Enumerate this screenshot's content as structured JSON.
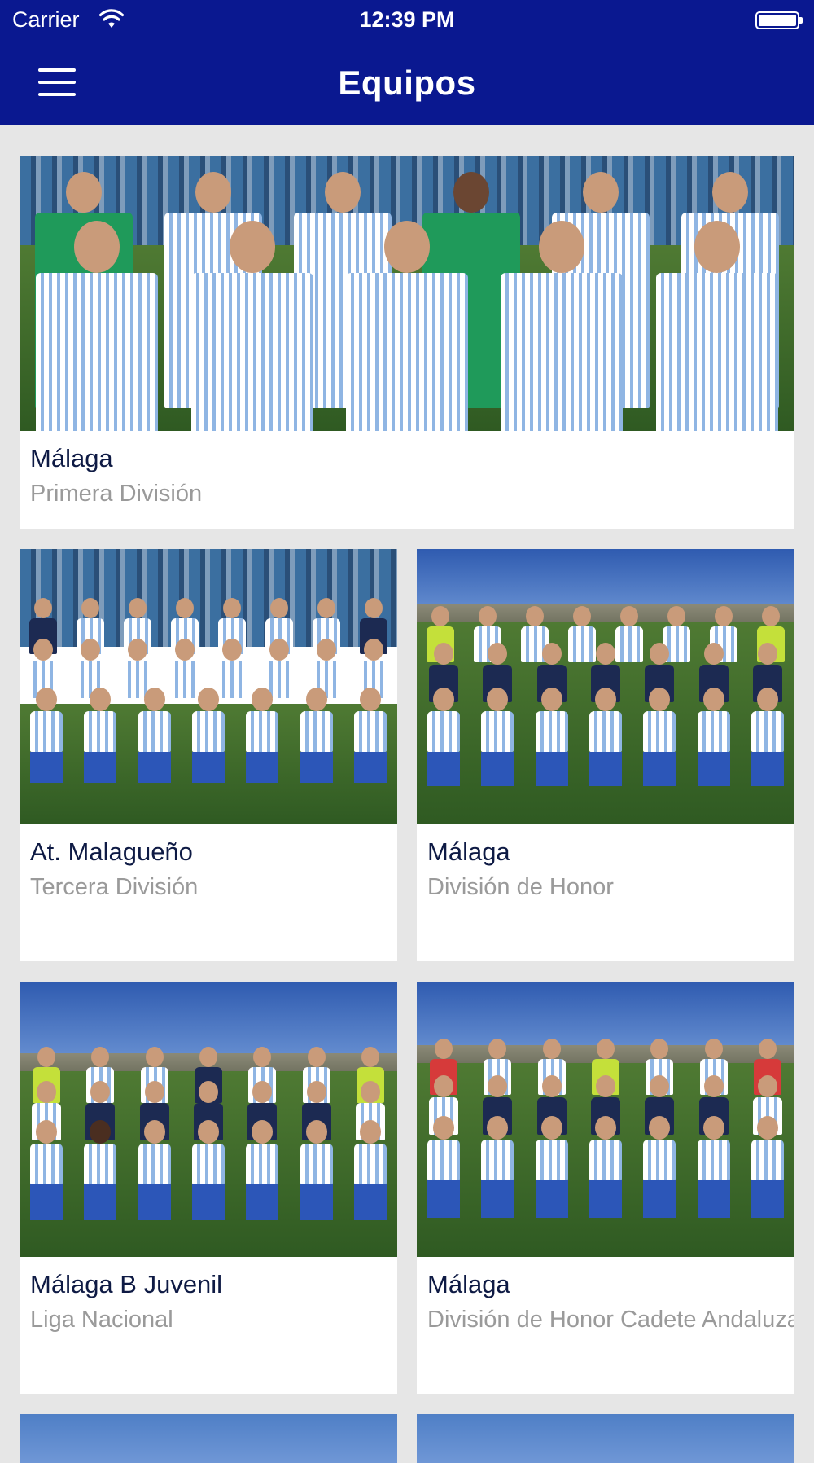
{
  "status_bar": {
    "carrier": "Carrier",
    "time": "12:39 PM",
    "icons": [
      "wifi-icon",
      "battery-icon"
    ]
  },
  "nav": {
    "title": "Equipos",
    "menu_icon": "hamburger-menu-icon"
  },
  "colors": {
    "header_bg": "#0a1890",
    "page_bg": "#e6e6e6",
    "team_name": "#0e1a44",
    "league_text": "#9a9a9a"
  },
  "teams": [
    {
      "name": "Málaga",
      "league": "Primera División"
    },
    {
      "name": "At. Malagueño",
      "league": "Tercera División"
    },
    {
      "name": "Málaga",
      "league": "División de Honor"
    },
    {
      "name": "Málaga B Juvenil",
      "league": "Liga Nacional"
    },
    {
      "name": "Málaga",
      "league": "División de Honor Cadete Andaluza"
    }
  ]
}
